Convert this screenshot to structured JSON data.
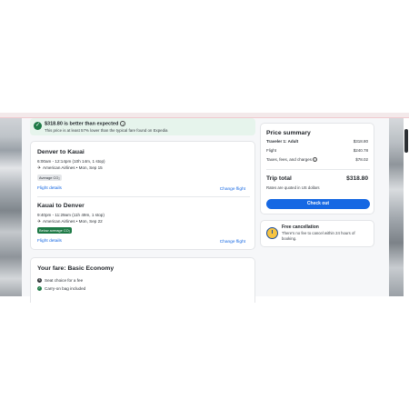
{
  "banner": {
    "title": "$318.80 is better than expected",
    "subtitle": "This price is at least 57% lower than the typical fare found on Expedia",
    "info_glyph": "i"
  },
  "flights": [
    {
      "route": "Denver to Kauai",
      "times": "6:00am - 12:14pm (10h 14m, 1 stop)",
      "airline": "American Airlines • Mon, Sep 15",
      "co2_badge": "Average CO₂",
      "details_link": "Flight details",
      "change_link": "Change flight"
    },
    {
      "route": "Kauai to Denver",
      "times": "9:40pm - 11:29am (11h 49m, 1 stop)",
      "airline": "American Airlines • Mon, Sep 22",
      "co2_badge": "Below average CO₂",
      "details_link": "Flight details",
      "change_link": "Change flight"
    }
  ],
  "fare": {
    "title": "Your fare: Basic Economy",
    "features": [
      {
        "icon": "seat-icon",
        "text": "Seat choice for a fee"
      },
      {
        "icon": "check-icon",
        "text": "Carry-on bag included"
      }
    ]
  },
  "price_summary": {
    "title": "Price summary",
    "rows": [
      {
        "label": "Traveler 1: Adult",
        "value": "$318.80"
      },
      {
        "label": "Flight",
        "value": "$240.78"
      },
      {
        "label": "Taxes, fees, and charges",
        "value": "$78.02"
      }
    ],
    "trip_total_label": "Trip total",
    "trip_total_value": "$318.80",
    "rates_note": "Rates are quoted in US dollars",
    "checkout_label": "Check out"
  },
  "free_cancellation": {
    "title": "Free cancellation",
    "text": "There's no fee to cancel within 24 hours of booking."
  },
  "colors": {
    "accent": "#1668e3",
    "success": "#1e7a46",
    "banner_bg": "#e6f4ec"
  }
}
